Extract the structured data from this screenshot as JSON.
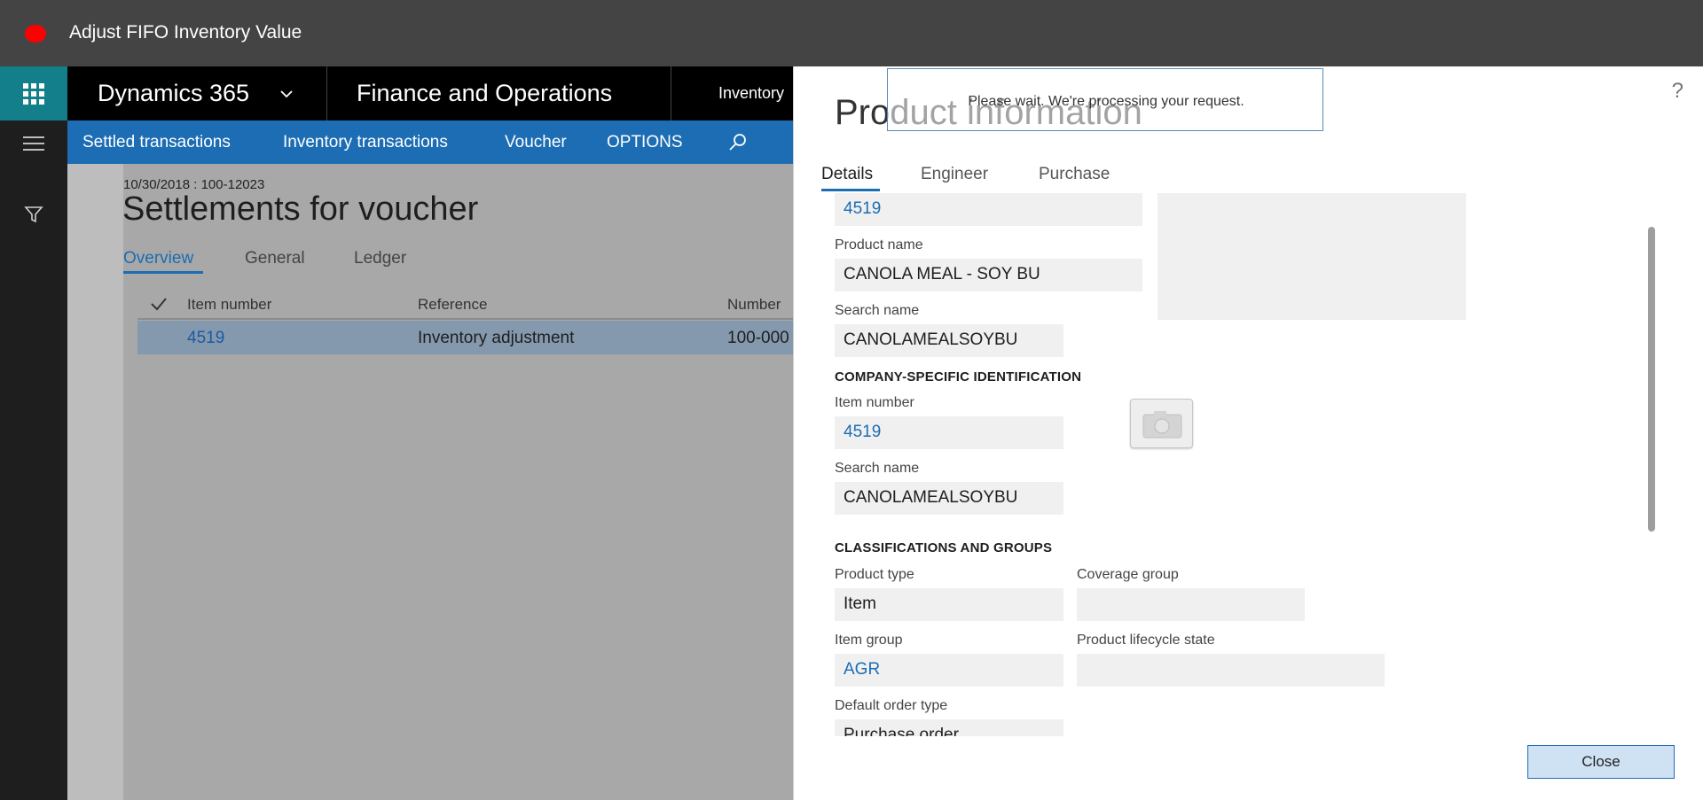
{
  "window": {
    "title": "Adjust FIFO Inventory Value"
  },
  "nav": {
    "product": "Dynamics 365",
    "suite": "Finance and Operations",
    "module": "Inventory"
  },
  "actions": [
    "Settled transactions",
    "Inventory transactions",
    "Voucher",
    "OPTIONS"
  ],
  "page": {
    "breadcrumb": "10/30/2018 : 100-12023",
    "title": "Settlements for voucher",
    "tabs": [
      "Overview",
      "General",
      "Ledger"
    ],
    "grid": {
      "headers": [
        "Item number",
        "Reference",
        "Number"
      ],
      "rows": [
        {
          "item_number": "4519",
          "reference": "Inventory adjustment",
          "number": "100-000"
        }
      ]
    }
  },
  "dialog": {
    "title": "Product information",
    "processing": "Please wait. We're processing your request.",
    "help": "?",
    "tabs": [
      "Details",
      "Engineer",
      "Purchase"
    ],
    "top_field_value": "4519",
    "product_name": {
      "label": "Product name",
      "value": "CANOLA MEAL - SOY BU"
    },
    "search_name": {
      "label": "Search name",
      "value": "CANOLAMEALSOYBU"
    },
    "section_company": "COMPANY-SPECIFIC IDENTIFICATION",
    "item_number": {
      "label": "Item number",
      "value": "4519"
    },
    "search_name2": {
      "label": "Search name",
      "value": "CANOLAMEALSOYBU"
    },
    "section_classifications": "CLASSIFICATIONS AND GROUPS",
    "product_type": {
      "label": "Product type",
      "value": "Item"
    },
    "coverage_group": {
      "label": "Coverage group",
      "value": ""
    },
    "item_group": {
      "label": "Item group",
      "value": "AGR"
    },
    "lifecycle_state": {
      "label": "Product lifecycle state",
      "value": ""
    },
    "default_order_type": {
      "label": "Default order type",
      "value": "Purchase order"
    },
    "close_label": "Close"
  },
  "colors": {
    "accent": "#1c6db4",
    "teal": "#127f8a",
    "record": "#ff0000"
  }
}
